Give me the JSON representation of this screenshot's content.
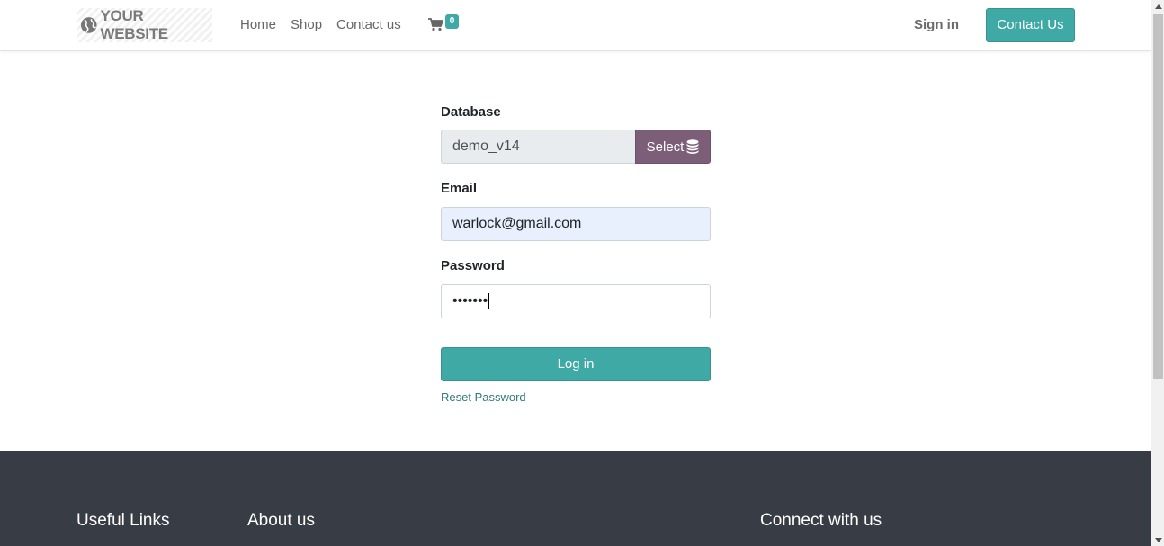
{
  "header": {
    "logo_text": "YOUR WEBSITE",
    "nav": [
      "Home",
      "Shop",
      "Contact us"
    ],
    "cart_count": "0",
    "sign_in": "Sign in",
    "contact_button": "Contact Us"
  },
  "form": {
    "database_label": "Database",
    "database_value": "demo_v14",
    "select_button": "Select",
    "email_label": "Email",
    "email_value": "warlock@gmail.com",
    "password_label": "Password",
    "password_masked": "•••••••",
    "login_button": "Log in",
    "reset_link": "Reset Password"
  },
  "footer": {
    "headings": [
      "Useful Links",
      "About us",
      "Connect with us"
    ]
  },
  "colors": {
    "primary": "#3fa9a6",
    "secondary": "#7c5e79",
    "footer_bg": "#383c44"
  },
  "icons": [
    "globe-icon",
    "cart-icon",
    "database-icon"
  ]
}
